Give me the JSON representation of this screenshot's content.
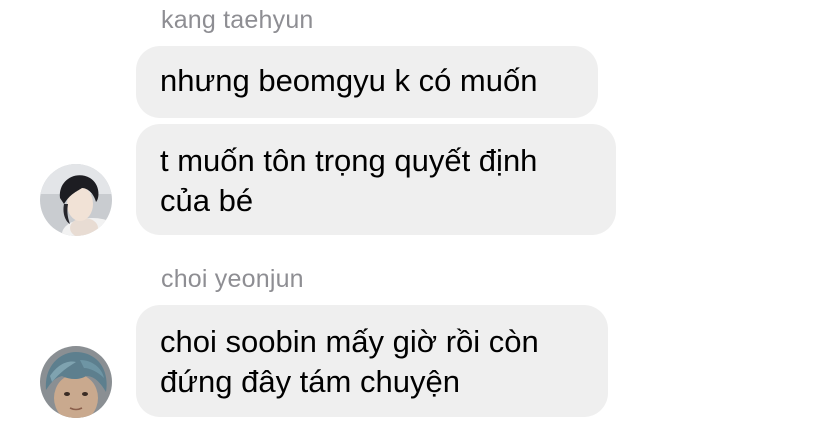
{
  "chat": {
    "groups": [
      {
        "sender": "kang taehyun",
        "messages": [
          {
            "lines": [
              "nhưng beomgyu k có muốn"
            ]
          },
          {
            "lines": [
              "t muốn tôn trọng quyết định",
              "của bé"
            ]
          }
        ],
        "avatar_icon": "avatar-photo-dark-hair"
      },
      {
        "sender": "choi yeonjun",
        "messages": [
          {
            "lines": [
              "choi soobin mấy giờ rồi còn",
              "đứng đây tám chuyện"
            ]
          }
        ],
        "avatar_icon": "avatar-photo-blue-hair"
      }
    ],
    "colors": {
      "bubble_background": "#efefef",
      "sender_name": "#8e8e93",
      "message_text": "#000000"
    }
  }
}
